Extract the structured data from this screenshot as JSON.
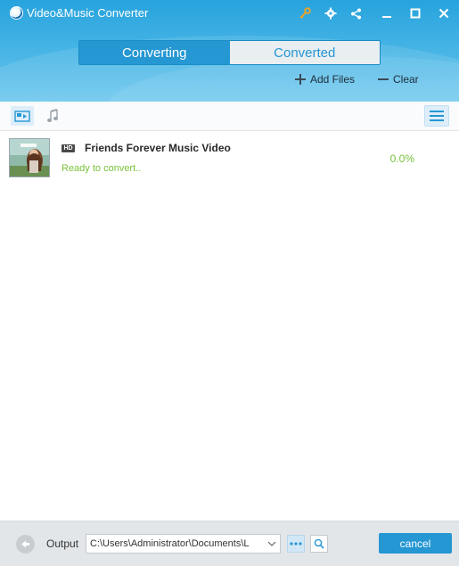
{
  "window": {
    "title": "Video&Music Converter",
    "icons": [
      "key-icon",
      "gear-icon",
      "share-icon",
      "minimize-icon",
      "maximize-icon",
      "close-icon"
    ]
  },
  "tabs": [
    {
      "label": "Converting",
      "active": true
    },
    {
      "label": "Converted",
      "active": false
    }
  ],
  "actions": {
    "add_files": "Add Files",
    "clear": "Clear"
  },
  "toolbar": {
    "icons": [
      "video-view-icon",
      "music-note-icon",
      "menu-icon"
    ]
  },
  "files": [
    {
      "badge": "HD",
      "title": "Friends Forever Music Video",
      "status": "Ready to convert..",
      "progress": "0.0%"
    }
  ],
  "footer": {
    "output_label": "Output",
    "output_path": "C:\\Users\\Administrator\\Documents\\L",
    "cancel_label": "cancel"
  },
  "colors": {
    "accent": "#2597d3",
    "status_green": "#7ac13a",
    "key_icon": "#f2a31d"
  }
}
